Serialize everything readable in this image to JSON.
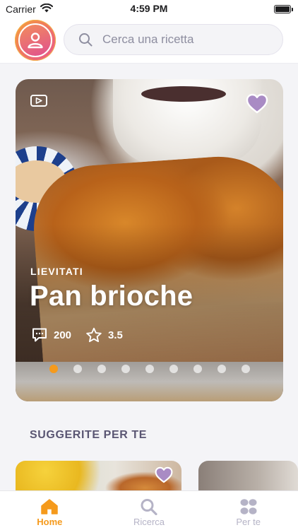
{
  "status_bar": {
    "carrier": "Carrier",
    "time": "4:59 PM"
  },
  "header": {
    "search_placeholder": "Cerca una ricetta"
  },
  "hero": {
    "category": "LIEVITATI",
    "title": "Pan brioche",
    "comments_count": "200",
    "rating": "3.5",
    "carousel_pages": 9,
    "active_page": 1
  },
  "section": {
    "title": "SUGGERITE PER TE"
  },
  "tabs": [
    {
      "label": "Home",
      "icon": "home-icon",
      "active": true
    },
    {
      "label": "Ricerca",
      "icon": "search-icon",
      "active": false
    },
    {
      "label": "Per te",
      "icon": "grid-icon",
      "active": false
    }
  ],
  "colors": {
    "accent": "#f59a1c",
    "favorite": "#a98bc4",
    "section_title": "#5a5673",
    "tab_inactive": "#b5b3c6"
  }
}
